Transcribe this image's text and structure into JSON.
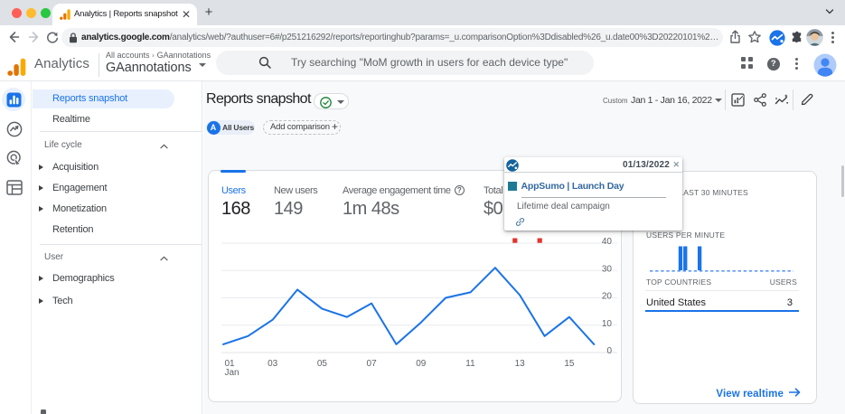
{
  "window": {
    "tab_title": "Analytics | Reports snapshot",
    "close_tab_glyph": "✕",
    "new_tab_glyph": "+"
  },
  "browser": {
    "url_host": "analytics.google.com",
    "url_path": "/analytics/web/?authuser=6#/p251216292/reports/reportinghub?params=_u.comparisonOption%3Ddisabled%26_u.date00%3D20220101%2…"
  },
  "ga_header": {
    "brand": "Analytics",
    "breadcrumb_account": "All accounts",
    "breadcrumb_property": "GAannotations",
    "property_selector": "GAannotations",
    "search_placeholder": "Try searching \"MoM growth in users for each device type\""
  },
  "nav": {
    "top_items": [
      {
        "label": "Reports snapshot",
        "active": true
      },
      {
        "label": "Realtime",
        "active": false
      }
    ],
    "sections": [
      {
        "label": "Life cycle",
        "items": [
          {
            "label": "Acquisition",
            "expandable": true
          },
          {
            "label": "Engagement",
            "expandable": true
          },
          {
            "label": "Monetization",
            "expandable": true
          },
          {
            "label": "Retention",
            "expandable": false
          }
        ]
      },
      {
        "label": "User",
        "items": [
          {
            "label": "Demographics",
            "expandable": true
          },
          {
            "label": "Tech",
            "expandable": true
          }
        ]
      }
    ]
  },
  "report_header": {
    "title": "Reports snapshot",
    "date_preset": "Custom",
    "date_range": "Jan 1 - Jan 16, 2022",
    "segment_initial": "A",
    "segment_chip": "All Users",
    "add_comparison_label": "Add comparison",
    "add_comparison_plus": "+"
  },
  "metrics": [
    {
      "label": "Users",
      "value": "168",
      "selected": true,
      "has_help": false
    },
    {
      "label": "New users",
      "value": "149",
      "selected": false,
      "has_help": false
    },
    {
      "label": "Average engagement time",
      "value": "1m 48s",
      "selected": false,
      "has_help": true
    },
    {
      "label": "Total revenue",
      "value": "$0.00",
      "selected": false,
      "has_help": false
    }
  ],
  "chart_data": {
    "type": "line",
    "series": [
      {
        "name": "Users",
        "values": [
          3,
          6,
          12,
          23,
          16,
          13,
          18,
          3,
          11,
          20,
          22,
          31,
          21,
          6,
          13,
          3
        ]
      }
    ],
    "categories": [
      "Jan 1",
      "Jan 2",
      "Jan 3",
      "Jan 4",
      "Jan 5",
      "Jan 6",
      "Jan 7",
      "Jan 8",
      "Jan 9",
      "Jan 10",
      "Jan 11",
      "Jan 12",
      "Jan 13",
      "Jan 14",
      "Jan 15",
      "Jan 16"
    ],
    "x_ticks": [
      {
        "day": 1,
        "label": "01",
        "sublabel": "Jan"
      },
      {
        "day": 3,
        "label": "03"
      },
      {
        "day": 5,
        "label": "05"
      },
      {
        "day": 7,
        "label": "07"
      },
      {
        "day": 9,
        "label": "09"
      },
      {
        "day": 11,
        "label": "11"
      },
      {
        "day": 13,
        "label": "13"
      },
      {
        "day": 15,
        "label": "15"
      }
    ],
    "y_ticks": [
      0,
      10,
      20,
      30,
      40
    ],
    "ylim": [
      0,
      40
    ],
    "line_color": "#1a73e8",
    "grid": true,
    "annotation_markers": {
      "days": [
        13,
        14
      ],
      "color": "#e0352b"
    }
  },
  "realtime": {
    "users_last_30min_label": "USERS IN LAST 30 MINUTES",
    "users_per_minute_label": "USERS PER MINUTE",
    "bars": [
      0,
      0,
      0,
      0,
      0,
      0,
      1,
      1,
      0,
      0,
      1,
      0,
      0,
      0,
      0,
      0,
      0,
      0,
      0,
      0,
      0,
      0,
      0,
      0,
      0,
      0,
      0,
      0,
      0,
      0
    ],
    "bar_color": "#1a73e8",
    "top_countries_label": "TOP COUNTRIES",
    "users_col_label": "USERS",
    "rows": [
      {
        "country": "United States",
        "users": "3"
      }
    ],
    "view_realtime_label": "View realtime"
  },
  "annotation_tooltip": {
    "date": "01/13/2022",
    "close_glyph": "✕",
    "title": "AppSumo | Launch Day",
    "description": "Lifetime deal campaign",
    "marker_color": "#1d7a96"
  },
  "colors": {
    "accent_blue": "#1a73e8",
    "selected_pill_bg": "#e8f0fe",
    "canvas_bg": "#f8f9fa",
    "tabstrip_bg": "#dee1e6",
    "annotation_red": "#e0352b",
    "tooltip_teal": "#1d7a96"
  }
}
